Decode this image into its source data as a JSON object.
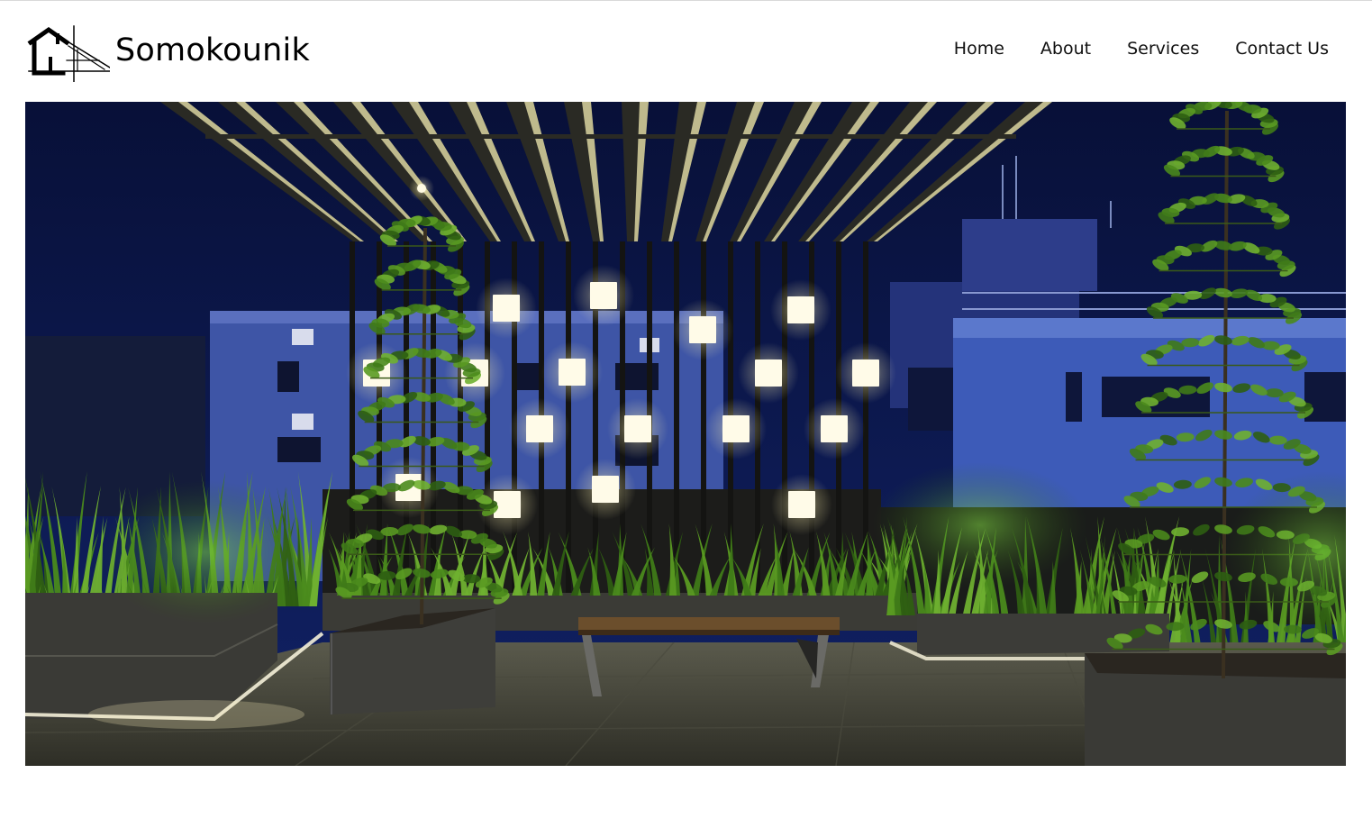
{
  "brand": {
    "name": "Somokounik",
    "logo_icon": "house-blueprint-icon"
  },
  "nav": {
    "items": [
      {
        "label": "Home"
      },
      {
        "label": "About"
      },
      {
        "label": "Services"
      },
      {
        "label": "Contact Us"
      }
    ]
  },
  "hero": {
    "image_subject": "night rooftop garden with pergola, lit cube lamps, bench and planters"
  },
  "colors": {
    "sky": "#0a1545",
    "building": "#3a4f9e",
    "foliage": "#4f8a1e",
    "lamp": "#fffbe8"
  }
}
